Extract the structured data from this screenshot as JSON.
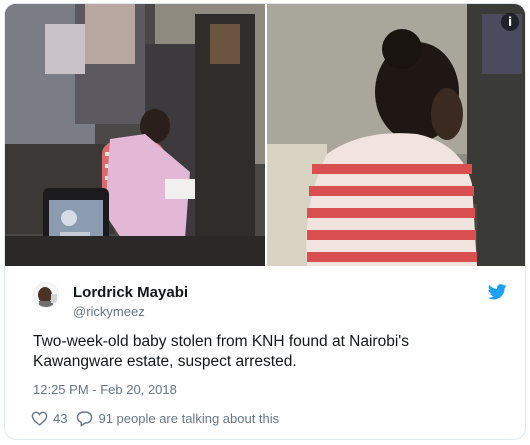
{
  "tweet": {
    "author": {
      "display_name": "Lordrick Mayabi",
      "handle": "@rickymeez"
    },
    "text": "Two-week-old baby stolen from KNH found at Nairobi's Kawangware estate, suspect arrested.",
    "timestamp": "12:25 PM - Feb 20, 2018",
    "likes": "43",
    "conversation": "91 people are talking about this"
  },
  "icons": {
    "info": "info-icon",
    "brand": "twitter-bird-icon",
    "like": "heart-icon",
    "reply": "speech-bubble-icon"
  },
  "colors": {
    "brand": "#1da1f2",
    "text": "#14171a",
    "secondary_text": "#657786",
    "border": "#e1e8ed"
  },
  "media": {
    "photo_count": 2,
    "info_glyph": "i"
  }
}
